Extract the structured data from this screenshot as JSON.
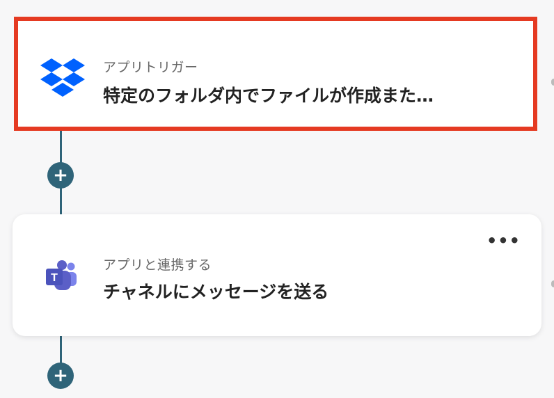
{
  "flow": {
    "steps": [
      {
        "type_label": "アプリトリガー",
        "title": "特定のフォルダ内でファイルが作成また…",
        "icon": "dropbox-icon",
        "highlight_color": "#e53a22"
      },
      {
        "type_label": "アプリと連携する",
        "title": "チャネルにメッセージを送る",
        "icon": "microsoft-teams-icon",
        "menu_label": "•••"
      }
    ],
    "add_label": "+",
    "colors": {
      "connector": "#2f6479",
      "dropbox_blue": "#0061fe",
      "teams_purple": "#5b5fc7",
      "background": "#f7f7f8"
    }
  }
}
